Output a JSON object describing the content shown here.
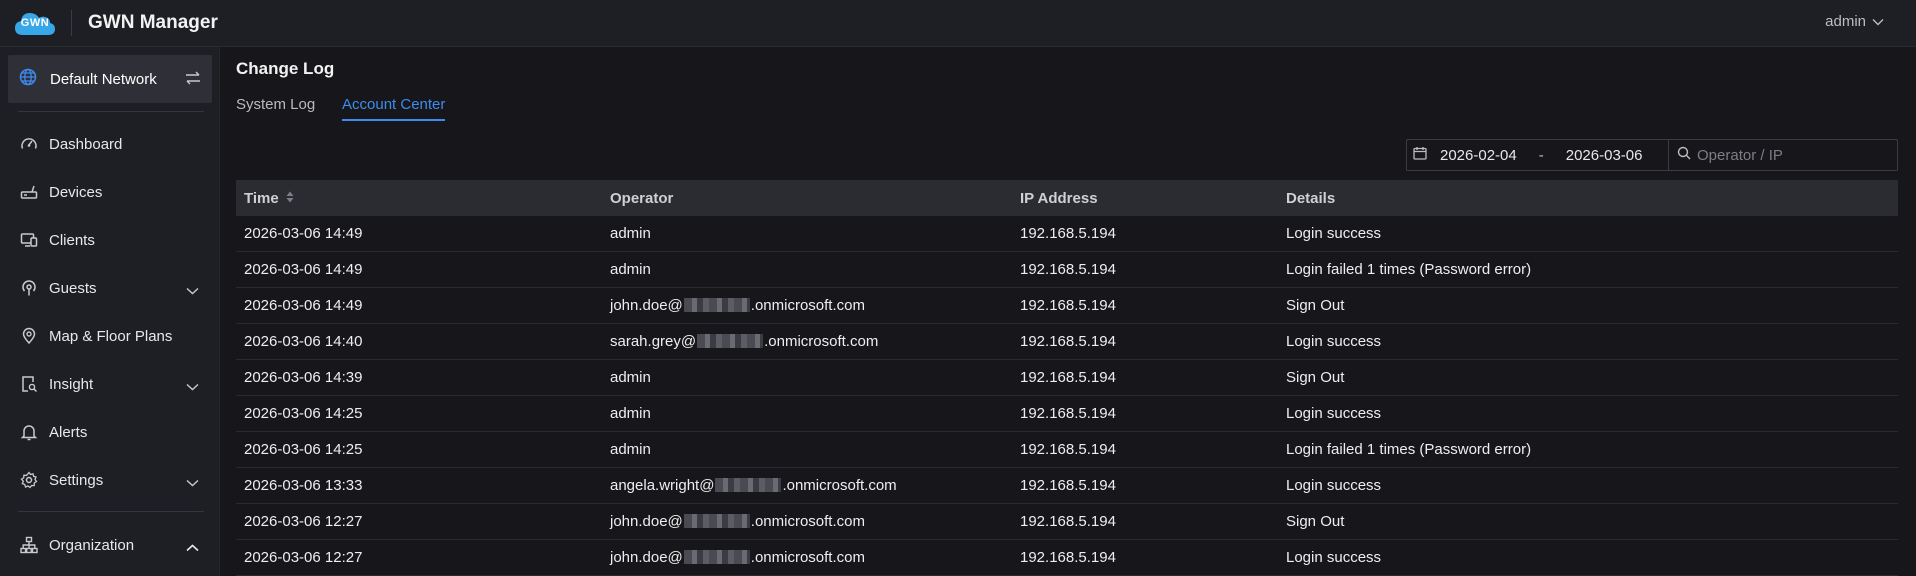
{
  "app": {
    "logo_text": "GWN",
    "title": "GWN Manager",
    "user": "admin"
  },
  "sidebar": {
    "network": "Default Network",
    "items": [
      {
        "label": "Dashboard",
        "icon": "speedometer-icon"
      },
      {
        "label": "Devices",
        "icon": "router-icon"
      },
      {
        "label": "Clients",
        "icon": "monitor-device-icon"
      },
      {
        "label": "Guests",
        "icon": "wifi-signal-icon",
        "expandable": true
      },
      {
        "label": "Map & Floor Plans",
        "icon": "map-pin-icon"
      },
      {
        "label": "Insight",
        "icon": "report-search-icon",
        "expandable": true
      },
      {
        "label": "Alerts",
        "icon": "bell-icon"
      },
      {
        "label": "Settings",
        "icon": "gear-icon",
        "expandable": true
      },
      {
        "label": "Organization",
        "icon": "org-chart-icon",
        "expanded": true
      }
    ]
  },
  "page": {
    "title": "Change Log",
    "tabs": [
      {
        "label": "System Log",
        "active": false
      },
      {
        "label": "Account Center",
        "active": true
      }
    ]
  },
  "filter": {
    "date_start": "2026-02-04",
    "date_sep": "-",
    "date_end": "2026-03-06",
    "search_placeholder": "Operator / IP"
  },
  "table": {
    "headers": [
      "Time",
      "Operator",
      "IP Address",
      "Details"
    ],
    "rows": [
      {
        "time": "2026-03-06 14:49",
        "op_prefix": "admin",
        "op_suffix": "",
        "ip": "192.168.5.194",
        "details": "Login success"
      },
      {
        "time": "2026-03-06 14:49",
        "op_prefix": "admin",
        "op_suffix": "",
        "ip": "192.168.5.194",
        "details": "Login failed 1 times (Password error)"
      },
      {
        "time": "2026-03-06 14:49",
        "op_prefix": "john.doe@",
        "op_suffix": ".onmicrosoft.com",
        "ip": "192.168.5.194",
        "details": "Sign Out"
      },
      {
        "time": "2026-03-06 14:40",
        "op_prefix": "sarah.grey@",
        "op_suffix": ".onmicrosoft.com",
        "ip": "192.168.5.194",
        "details": "Login success"
      },
      {
        "time": "2026-03-06 14:39",
        "op_prefix": "admin",
        "op_suffix": "",
        "ip": "192.168.5.194",
        "details": "Sign Out"
      },
      {
        "time": "2026-03-06 14:25",
        "op_prefix": "admin",
        "op_suffix": "",
        "ip": "192.168.5.194",
        "details": "Login success"
      },
      {
        "time": "2026-03-06 14:25",
        "op_prefix": "admin",
        "op_suffix": "",
        "ip": "192.168.5.194",
        "details": "Login failed 1 times (Password error)"
      },
      {
        "time": "2026-03-06 13:33",
        "op_prefix": "angela.wright@",
        "op_suffix": ".onmicrosoft.com",
        "ip": "192.168.5.194",
        "details": "Login success"
      },
      {
        "time": "2026-03-06 12:27",
        "op_prefix": "john.doe@",
        "op_suffix": ".onmicrosoft.com",
        "ip": "192.168.5.194",
        "details": "Sign Out"
      },
      {
        "time": "2026-03-06 12:27",
        "op_prefix": "john.doe@",
        "op_suffix": ".onmicrosoft.com",
        "ip": "192.168.5.194",
        "details": "Login success"
      }
    ]
  },
  "colors": {
    "accent": "#3d8bef",
    "background": "#17171b",
    "panel": "#1e1f24"
  }
}
